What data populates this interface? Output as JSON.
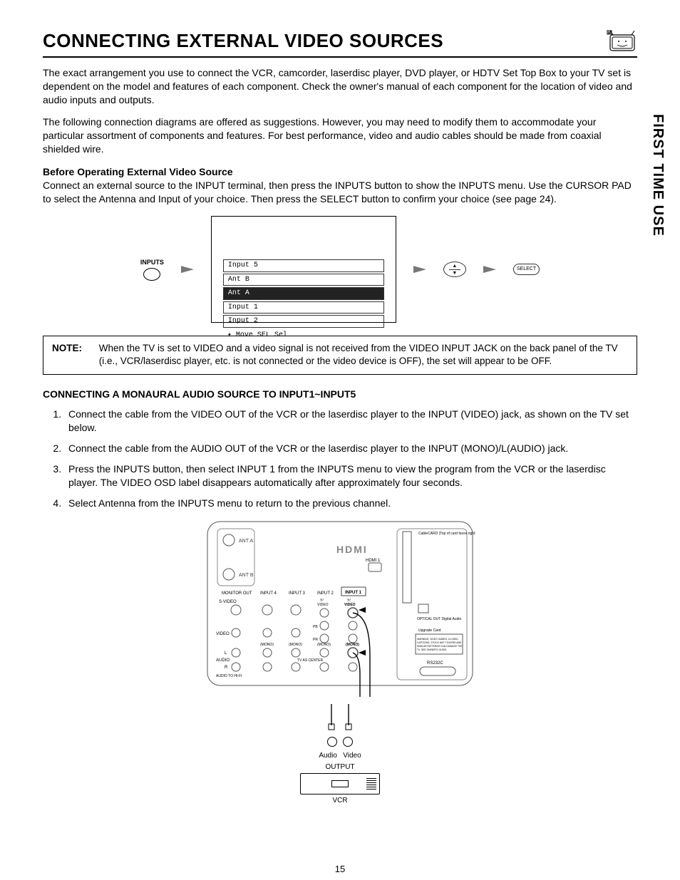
{
  "side_tab": "FIRST TIME USE",
  "title": "CONNECTING EXTERNAL VIDEO SOURCES",
  "intro1": "The exact arrangement you use to connect the VCR, camcorder, laserdisc player, DVD player, or HDTV Set Top Box to your TV set is dependent on the model and features of each component.  Check the owner's manual of each component for the location of video and audio inputs and outputs.",
  "intro2": "The following connection diagrams are offered as suggestions.  However, you may need to modify them to accommodate your particular assortment of components and features.  For best performance, video and audio cables should be made from coaxial shielded wire.",
  "before_head": "Before Operating External Video Source",
  "before_body": "Connect an external source to the INPUT terminal, then press the INPUTS button to show the INPUTS menu.  Use the CURSOR PAD to select the Antenna and Input of your choice.  Then press the SELECT button to confirm your choice (see page 24).",
  "diagram": {
    "inputs_label": "INPUTS",
    "menu": [
      "Input 5",
      "Ant B",
      "Ant A",
      "Input 1",
      "Input 2"
    ],
    "menu_selected": "Ant A",
    "hint": "Move   SEL  Sel",
    "select_label": "SELECT"
  },
  "note": {
    "label": "NOTE:",
    "text": "When the TV is set to VIDEO and a video signal is not received from the VIDEO INPUT JACK on the back panel of the TV (i.e., VCR/laserdisc player, etc. is not connected or the video device is OFF), the set will appear to be OFF."
  },
  "section_head": "CONNECTING A MONAURAL AUDIO SOURCE TO INPUT1~INPUT5",
  "steps": [
    "Connect the cable from the VIDEO OUT of the VCR or the laserdisc player to the INPUT (VIDEO) jack, as shown on the TV set below.",
    "Connect the cable from the AUDIO OUT of the VCR or the laserdisc player to the INPUT (MONO)/L(AUDIO) jack.",
    "Press the INPUTS button, then select INPUT 1 from the INPUTS menu to view the program from the VCR or the laserdisc player.  The VIDEO OSD label disappears automatically after approximately four seconds.",
    "Select Antenna from the INPUTS menu to return to the previous channel."
  ],
  "back_panel": {
    "ant_a": "ANT A",
    "ant_b": "ANT B",
    "monitor_out": "MONITOR OUT",
    "input4": "INPUT 4",
    "input3": "INPUT 3",
    "input2": "INPUT 2",
    "input1": "INPUT 1",
    "svideo": "S-VIDEO",
    "video": "VIDEO",
    "y_video": "Y/\nVIDEO",
    "pb": "PB",
    "pr": "PR",
    "mono": "(MONO)",
    "l": "L",
    "r": "R",
    "audio": "AUDIO",
    "tohifi": "AUDIO\nTO HI-FI",
    "tv_center": "TV AS CENTER",
    "hdmi_logo": "HDMI",
    "hdmi1": "HDMI 1",
    "cablecard": "CableCARD\n(Top of card faces right)",
    "optical": "OPTICAL OUT\nDigital Audio",
    "upgrade": "Upgrade Card",
    "rs232c": "RS232C",
    "warning": "WARNING: VIDEO GAMES, CLOSED CAPTIONS, STOCK MKT TICKERS AND SIMILAR PATTERNS CAN DAMAGE THE TV. SEE OWNER'S GUIDE."
  },
  "vcr": {
    "audio": "Audio",
    "video": "Video",
    "output": "OUTPUT",
    "label": "VCR"
  },
  "page_number": "15"
}
